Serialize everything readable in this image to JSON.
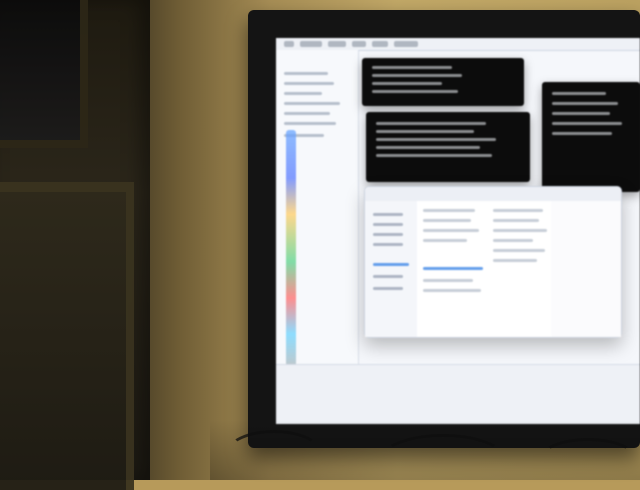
{
  "scene": {
    "description_text": "",
    "colors": {
      "wall": "#b79a5a",
      "monitor_bezel": "#141414",
      "screen_bg": "#f5f7fb",
      "terminal_bg": "#0c0c0c",
      "finder_selection": "#4a8ee8"
    },
    "objects": [
      {
        "name": "door-window",
        "kind": "window"
      },
      {
        "name": "door-panel",
        "kind": "door"
      },
      {
        "name": "monitor",
        "kind": "computer-monitor"
      },
      {
        "name": "screen",
        "kind": "display"
      },
      {
        "name": "dock",
        "kind": "app-dock"
      },
      {
        "name": "terminal-top-left",
        "kind": "terminal-window"
      },
      {
        "name": "terminal-top-right",
        "kind": "terminal-window"
      },
      {
        "name": "terminal-middle",
        "kind": "terminal-window"
      },
      {
        "name": "finder-window",
        "kind": "file-browser-window"
      },
      {
        "name": "cables",
        "kind": "cables"
      }
    ]
  }
}
